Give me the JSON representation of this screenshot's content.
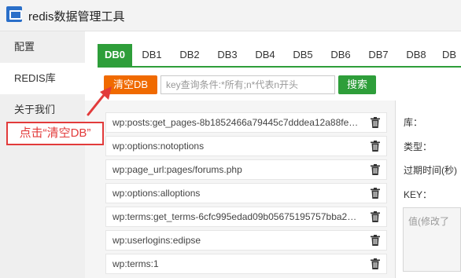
{
  "window": {
    "title": "redis数据管理工具",
    "icon": "app-icon"
  },
  "sidebar": {
    "items": [
      {
        "label": "配置",
        "active": false
      },
      {
        "label": "REDIS库",
        "active": true
      },
      {
        "label": "关于我们",
        "active": false
      }
    ]
  },
  "tabs": [
    {
      "label": "DB0",
      "active": true
    },
    {
      "label": "DB1",
      "active": false
    },
    {
      "label": "DB2",
      "active": false
    },
    {
      "label": "DB3",
      "active": false
    },
    {
      "label": "DB4",
      "active": false
    },
    {
      "label": "DB5",
      "active": false
    },
    {
      "label": "DB6",
      "active": false
    },
    {
      "label": "DB7",
      "active": false
    },
    {
      "label": "DB8",
      "active": false
    },
    {
      "label": "DB",
      "active": false
    }
  ],
  "toolbar": {
    "clear_label": "清空DB",
    "search_placeholder": "key查询条件:*所有;n*代表n开头",
    "search_value": "",
    "search_label": "搜索"
  },
  "keys": [
    "wp:posts:get_pages-8b1852466a79445c7dddea12a88fe…",
    "wp:options:notoptions",
    "wp:page_url:pages/forums.php",
    "wp:options:alloptions",
    "wp:terms:get_terms-6cfc995edad09b05675195757bba2…",
    "wp:userlogins:edipse",
    "wp:terms:1"
  ],
  "detail": {
    "db_label": "库：",
    "type_label": "类型：",
    "ttl_label": "过期时间(秒)",
    "key_label": "KEY：",
    "value_placeholder": "值(修改了"
  },
  "annotation": {
    "text": "点击“清空DB”",
    "color": "#e23b3b"
  },
  "colors": {
    "accent_green": "#2e9e3a",
    "clear_orange": "#f06a00",
    "annotation_red": "#e23b3b"
  }
}
